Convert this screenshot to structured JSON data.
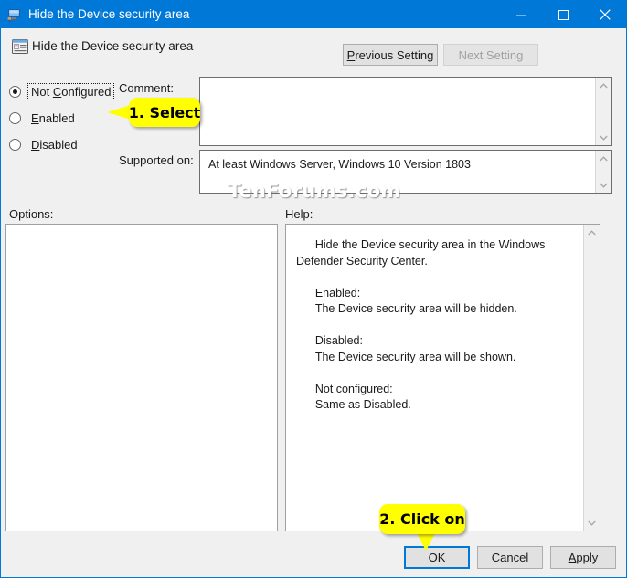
{
  "window": {
    "title": "Hide the Device security area",
    "title_icon": "computer-monitor-icon",
    "controls": {
      "minimize": "minimize-icon",
      "maximize": "maximize-icon",
      "close": "close-icon"
    },
    "accent_color": "#0078d7",
    "chrome_color": "#f0f0f0"
  },
  "header": {
    "icon": "group-policy-setting-icon",
    "title": "Hide the Device security area",
    "previous_setting_label": "Previous Setting",
    "previous_setting_accel": "P",
    "next_setting_label": "Next Setting",
    "next_setting_enabled": false
  },
  "state_options": {
    "selected": "Not Configured",
    "items": [
      {
        "label": "Not Configured",
        "accel": "C",
        "checked": true,
        "focused": true
      },
      {
        "label": "Enabled",
        "accel": "E",
        "checked": false,
        "focused": false
      },
      {
        "label": "Disabled",
        "accel": "D",
        "checked": false,
        "focused": false
      }
    ]
  },
  "fields": {
    "comment_label": "Comment:",
    "comment_value": "",
    "supported_label": "Supported on:",
    "supported_value": "At least Windows Server, Windows 10 Version 1803"
  },
  "options_panel": {
    "label": "Options:",
    "content": ""
  },
  "help_panel": {
    "label": "Help:",
    "content": "      Hide the Device security area in the Windows Defender Security Center.\n\n      Enabled:\n      The Device security area will be hidden.\n\n      Disabled:\n      The Device security area will be shown.\n\n      Not configured:\n      Same as Disabled."
  },
  "footer": {
    "ok_label": "OK",
    "ok_is_default": true,
    "cancel_label": "Cancel",
    "apply_label": "Apply",
    "apply_accel": "A"
  },
  "annotations": {
    "callout_1": "1. Select",
    "callout_2": "2. Click on",
    "callout_color": "#ffff00"
  },
  "watermark": "TenForums.com"
}
